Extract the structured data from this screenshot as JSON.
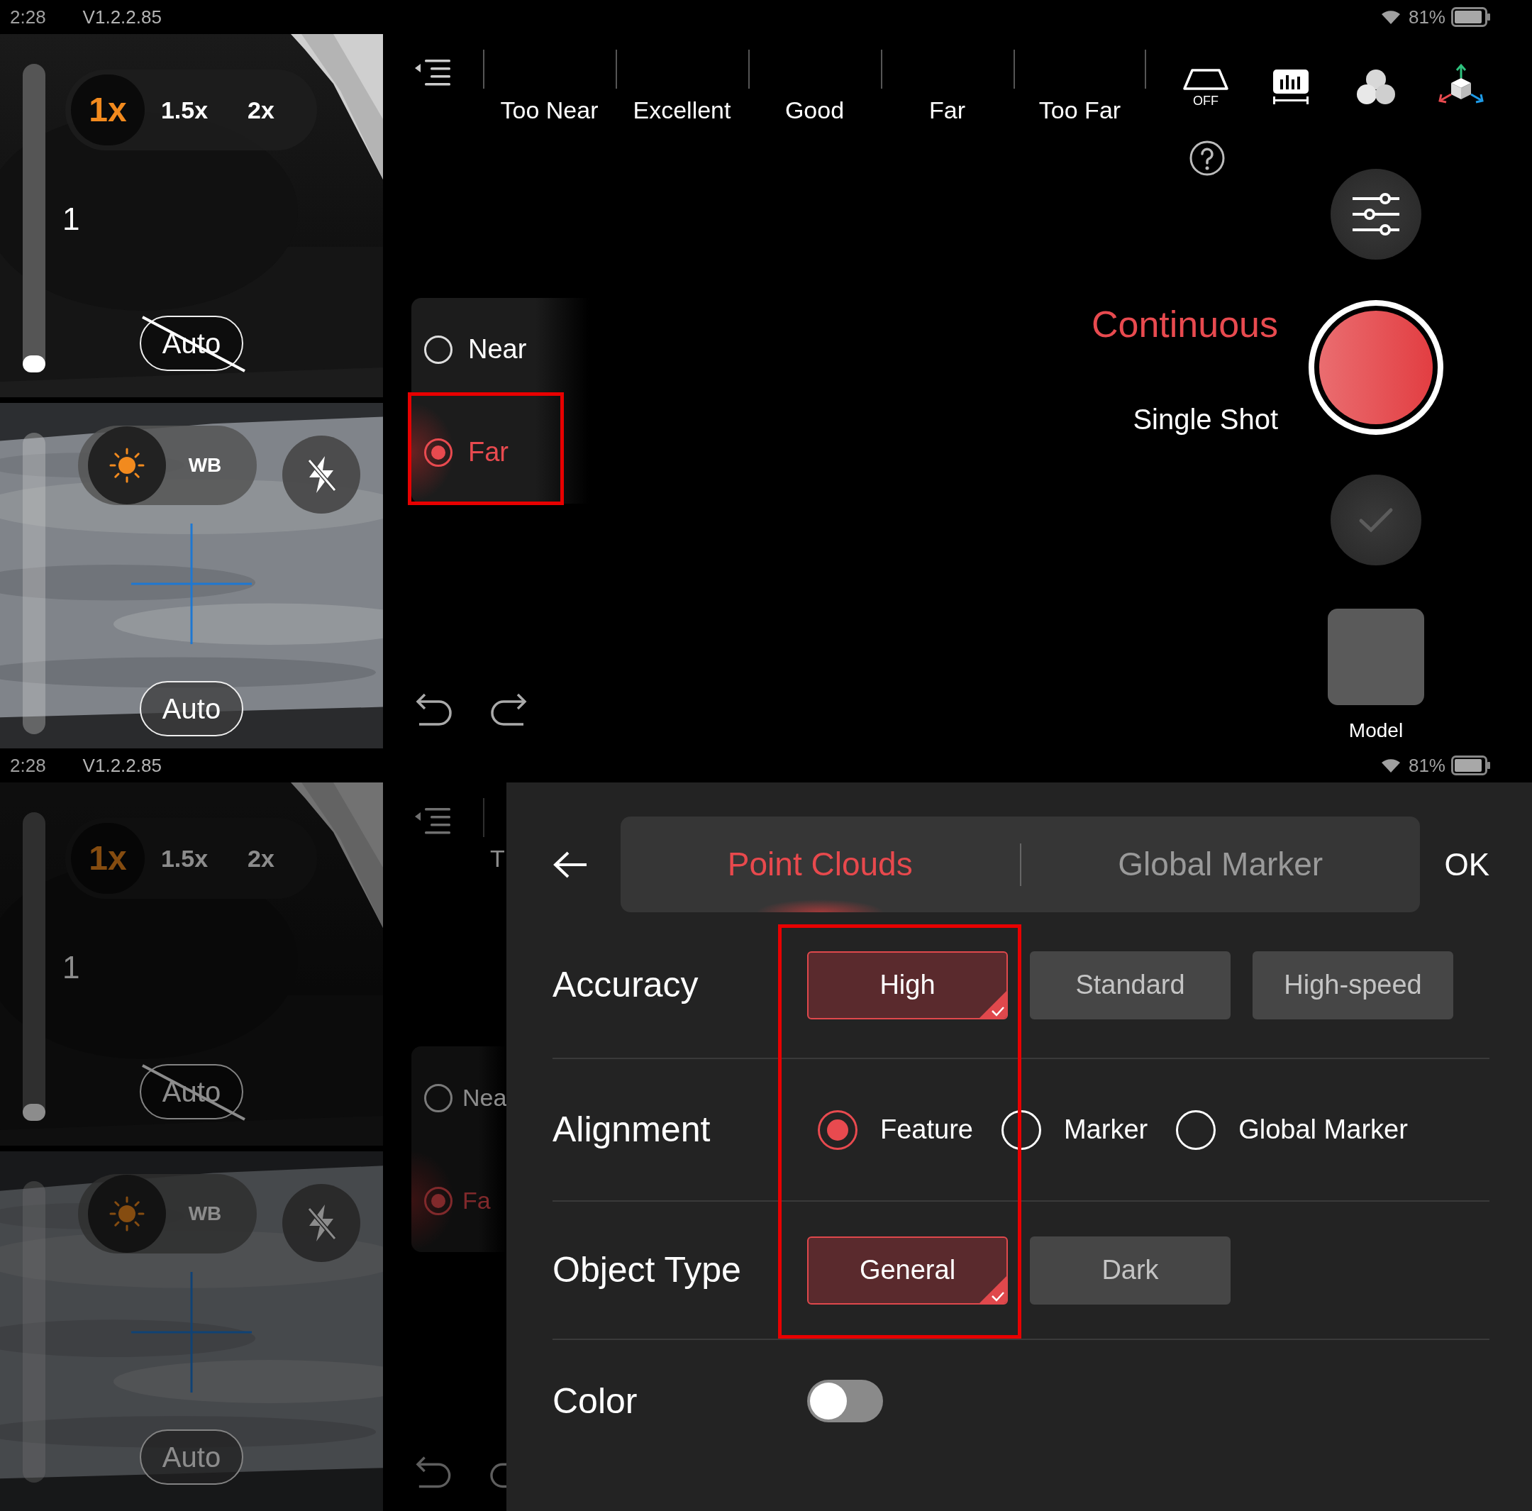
{
  "screens": [
    {
      "status_bar": {
        "time": "2:28",
        "version": "V1.2.2.85",
        "battery": "81%"
      },
      "camera": {
        "zoom_options": [
          {
            "label": "1x",
            "selected": true
          },
          {
            "label": "1.5x",
            "selected": false
          },
          {
            "label": "2x",
            "selected": false
          }
        ],
        "zoom_slider": {
          "level": 0
        },
        "zoom_value": "1",
        "focus_auto": {
          "label": "Auto",
          "disabled": true
        },
        "exposure_modes": [
          {
            "kind": "sun",
            "selected": true
          },
          {
            "kind": "text",
            "label": "WB",
            "selected": false
          }
        ],
        "flash": {
          "on": false
        },
        "exposure_auto": {
          "label": "Auto",
          "disabled": false
        }
      },
      "toolbar": {
        "distance_labels": [
          "Too Near",
          "Excellent",
          "Good",
          "Far",
          "Too Far"
        ],
        "keystone": {
          "label": "OFF"
        }
      },
      "distance_options": [
        {
          "label": "Near",
          "selected": false,
          "highlighted": false
        },
        {
          "label": "Far",
          "selected": true,
          "highlighted": true
        }
      ],
      "capture_modes": [
        {
          "label": "Continuous",
          "selected": true
        },
        {
          "label": "Single Shot",
          "selected": false
        }
      ],
      "confirm": {
        "disabled": true
      },
      "model": {
        "label": "Model"
      }
    },
    {
      "status_bar": {
        "time": "2:28",
        "version": "V1.2.2.85",
        "battery": "81%"
      },
      "dimmed": true,
      "camera": {
        "zoom_options": [
          {
            "label": "1x",
            "selected": true
          },
          {
            "label": "1.5x",
            "selected": false
          },
          {
            "label": "2x",
            "selected": false
          }
        ],
        "zoom_slider": {
          "level": 0
        },
        "zoom_value": "1",
        "focus_auto": {
          "label": "Auto",
          "disabled": true
        },
        "exposure_modes": [
          {
            "kind": "sun",
            "selected": true
          },
          {
            "kind": "text",
            "label": "WB",
            "selected": false
          }
        ],
        "flash": {
          "on": false
        },
        "exposure_auto": {
          "label": "Auto",
          "disabled": false
        }
      },
      "toolbar": {
        "distance_labels": [
          "T"
        ]
      },
      "distance_options": [
        {
          "label": "Nea",
          "selected": false,
          "highlighted": false
        },
        {
          "label": "Fa",
          "selected": true,
          "highlighted": false
        }
      ],
      "settings": {
        "tabs": [
          {
            "label": "Point Clouds",
            "selected": true
          },
          {
            "label": "Global Marker",
            "selected": false
          }
        ],
        "ok": "OK",
        "highlighted": true,
        "rows": [
          {
            "kind": "buttons",
            "label": "Accuracy",
            "options": [
              {
                "label": "High",
                "selected": true
              },
              {
                "label": "Standard",
                "selected": false
              },
              {
                "label": "High-speed",
                "selected": false
              }
            ]
          },
          {
            "kind": "radios",
            "label": "Alignment",
            "options": [
              {
                "label": "Feature",
                "selected": true
              },
              {
                "label": "Marker",
                "selected": false
              },
              {
                "label": "Global Marker",
                "selected": false
              }
            ]
          },
          {
            "kind": "buttons",
            "label": "Object Type",
            "options": [
              {
                "label": "General",
                "selected": true
              },
              {
                "label": "Dark",
                "selected": false
              }
            ]
          },
          {
            "kind": "toggle",
            "label": "Color",
            "on": false
          }
        ]
      }
    }
  ]
}
